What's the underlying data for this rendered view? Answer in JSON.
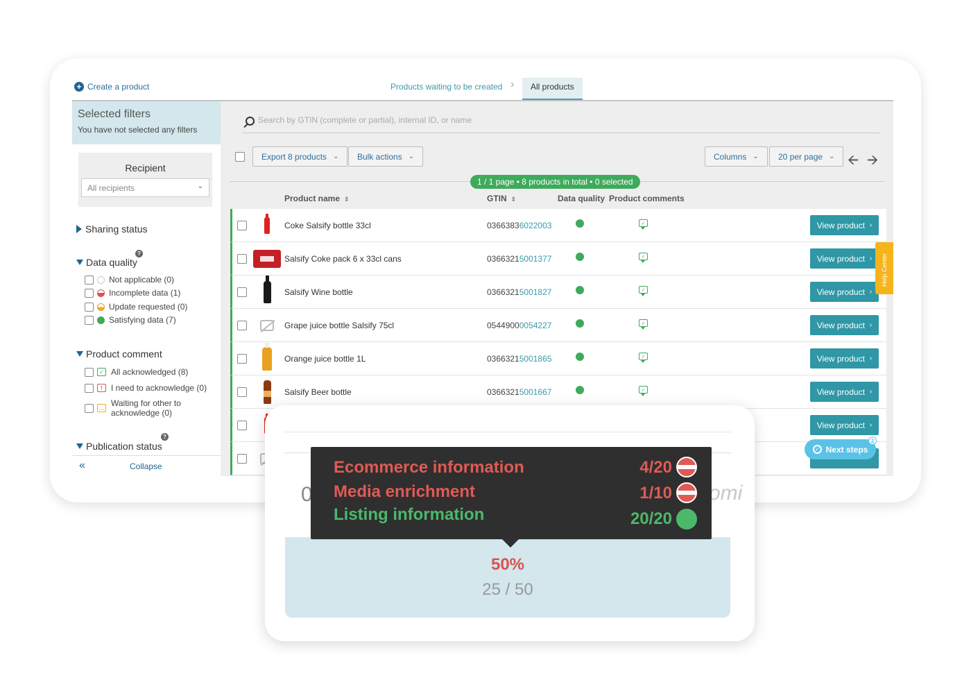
{
  "header": {
    "create_label": "Create a product",
    "crumb_waiting": "Products waiting to be created",
    "crumb_separator": "›",
    "crumb_all": "All products"
  },
  "sidebar": {
    "selected_title": "Selected filters",
    "selected_sub": "You have not selected any filters",
    "recipient_title": "Recipient",
    "recipient_value": "All recipients",
    "sharing_status": "Sharing status",
    "data_quality": {
      "title": "Data quality",
      "items": [
        {
          "label": "Not applicable (0)",
          "status": "na"
        },
        {
          "label": "Incomplete data (1)",
          "status": "incomplete"
        },
        {
          "label": "Update requested (0)",
          "status": "update"
        },
        {
          "label": "Satisfying data (7)",
          "status": "satisfying"
        }
      ]
    },
    "product_comment": {
      "title": "Product comment",
      "items": [
        {
          "label": "All acknowledged (8)",
          "icon": "comment-check-icon"
        },
        {
          "label": "I need to acknowledge (0)",
          "icon": "comment-alert-icon"
        },
        {
          "label_line1": "Waiting for other to",
          "label_line2": "acknowledge (0)",
          "icon": "comment-wait-icon"
        }
      ]
    },
    "publication_status": "Publication status",
    "collapse_label": "Collapse"
  },
  "toolbar": {
    "search_placeholder": "Search by GTIN (complete or partial), internal ID, or name",
    "export_label": "Export 8 products",
    "bulk_label": "Bulk actions",
    "columns_label": "Columns",
    "per_page_label": "20 per page",
    "page_info": "1 / 1 page  •  8 products in total  •  0 selected"
  },
  "table": {
    "columns": {
      "name": "Product name",
      "gtin": "GTIN",
      "quality": "Data quality",
      "comments": "Product comments"
    },
    "view_label": "View product",
    "rows": [
      {
        "name": "Coke Salsify bottle 33cl",
        "gtin_prefix": "0366383",
        "gtin_suffix": "6022003",
        "thumb": "red-bottle"
      },
      {
        "name": "Salsify Coke pack 6 x 33cl cans",
        "gtin_prefix": "0366321",
        "gtin_suffix": "5001377",
        "thumb": "can-pack"
      },
      {
        "name": "Salsify Wine bottle",
        "gtin_prefix": "0366321",
        "gtin_suffix": "5001827",
        "thumb": "wine-bottle"
      },
      {
        "name": "Grape juice bottle Salsify 75cl",
        "gtin_prefix": "0544900",
        "gtin_suffix": "0054227",
        "thumb": "no-image"
      },
      {
        "name": "Orange juice bottle 1L",
        "gtin_prefix": "0366321",
        "gtin_suffix": "5001865",
        "thumb": "juice-bottle"
      },
      {
        "name": "Salsify Beer bottle",
        "gtin_prefix": "0366321",
        "gtin_suffix": "5001667",
        "thumb": "beer-bottle"
      },
      {
        "name": "",
        "gtin_prefix": "",
        "gtin_suffix": "",
        "thumb": "red-bottle"
      },
      {
        "name": "",
        "gtin_prefix": "",
        "gtin_suffix": "",
        "thumb": "no-image"
      }
    ]
  },
  "help_center": "Help Center",
  "next_steps": {
    "label": "Next steps",
    "badge": "2"
  },
  "zoom": {
    "ghost_left": "0",
    "ghost_right": "omi",
    "tooltip": [
      {
        "label": "Ecommerce information",
        "value": "4/20",
        "status": "incomplete",
        "color": "#e05a55"
      },
      {
        "label": "Media enrichment",
        "value": "1/10",
        "status": "incomplete",
        "color": "#e05a55"
      },
      {
        "label": "Listing information",
        "value": "20/20",
        "status": "satisfying",
        "color": "#4cb86a"
      }
    ],
    "score_percent": "50%",
    "score_fraction": "25 / 50"
  },
  "colors": {
    "accent": "#2f97a6",
    "success": "#3eaa5c",
    "warning": "#f6b41c",
    "danger": "#d9534f",
    "info": "#5bc2e7"
  }
}
